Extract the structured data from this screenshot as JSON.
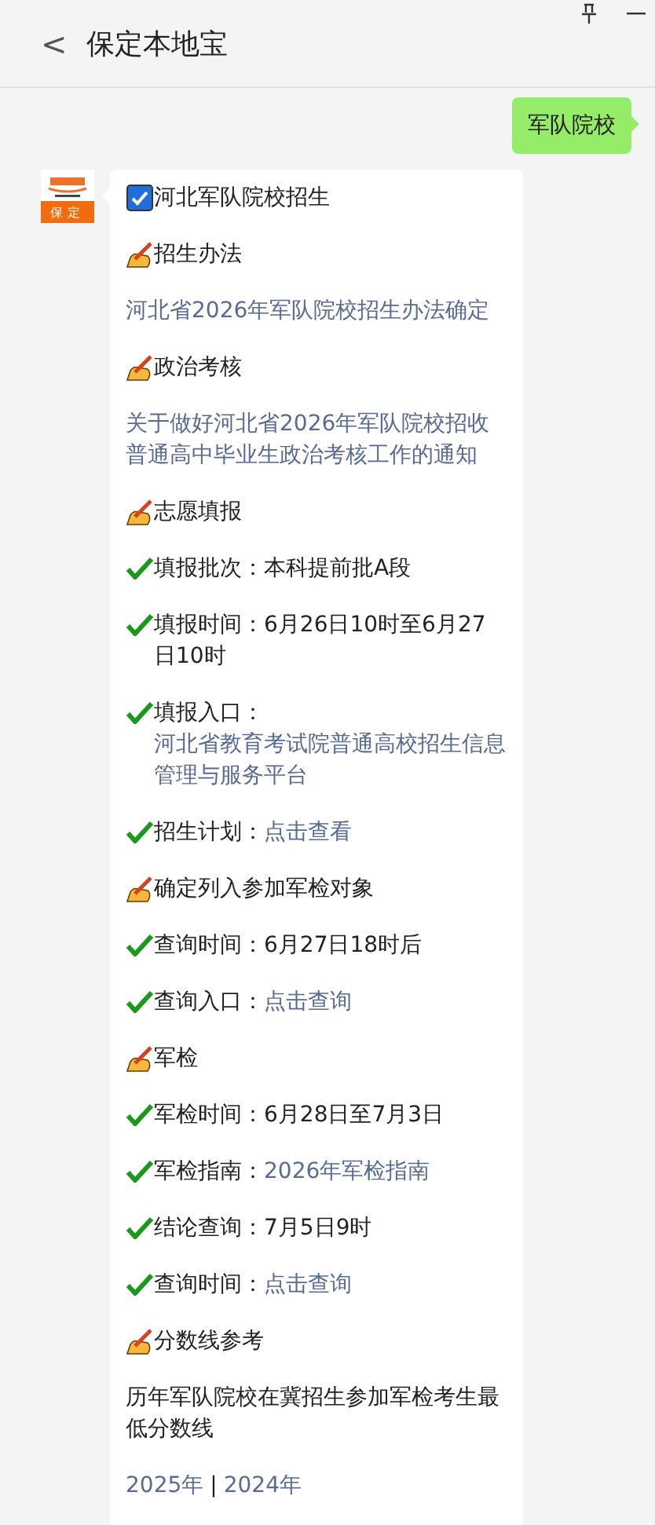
{
  "header": {
    "back": "<",
    "title": "保定本地宝"
  },
  "sent_message": {
    "text": "军队院校"
  },
  "avatar": {
    "label": "保定"
  },
  "article": [
    {
      "kind": "heading",
      "text": "河北军队院校招生"
    },
    {
      "kind": "section",
      "text": "招生办法"
    },
    {
      "kind": "link",
      "text": "河北省2026年军队院校招生办法确定"
    },
    {
      "kind": "section",
      "text": "政治考核"
    },
    {
      "kind": "link",
      "text": "关于做好河北省2026年军队院校招收普通高中毕业生政治考核工作的通知"
    },
    {
      "kind": "section",
      "text": "志愿填报"
    },
    {
      "kind": "check",
      "label": "填报批次：",
      "value": "本科提前批A段",
      "linked": false
    },
    {
      "kind": "check",
      "label": "填报时间：",
      "value": "6月26日10时至6月27日10时",
      "linked": false
    },
    {
      "kind": "check",
      "label": "填报入口：",
      "value": "河北省教育考试院普通高校招生信息管理与服务平台",
      "linked": true
    },
    {
      "kind": "check",
      "label": "招生计划：",
      "value": "点击查看",
      "linked": true
    },
    {
      "kind": "section",
      "text": "确定列入参加军检对象"
    },
    {
      "kind": "check",
      "label": "查询时间：",
      "value": "6月27日18时后",
      "linked": false
    },
    {
      "kind": "check",
      "label": "查询入口：",
      "value": "点击查询",
      "linked": true
    },
    {
      "kind": "section",
      "text": "军检"
    },
    {
      "kind": "check",
      "label": "军检时间：",
      "value": "6月28日至7月3日",
      "linked": false
    },
    {
      "kind": "check",
      "label": "军检指南：",
      "value": "2026年军检指南",
      "linked": true
    },
    {
      "kind": "check",
      "label": "结论查询：",
      "value": "7月5日9时",
      "linked": false
    },
    {
      "kind": "check",
      "label": "查询时间：",
      "value": "点击查询",
      "linked": true
    },
    {
      "kind": "section",
      "text": "分数线参考"
    },
    {
      "kind": "text",
      "text": "历年军队院校在冀招生参加军检考生最低分数线"
    },
    {
      "kind": "years",
      "links": [
        "2025年",
        "2024年"
      ],
      "separator": "|"
    }
  ]
}
